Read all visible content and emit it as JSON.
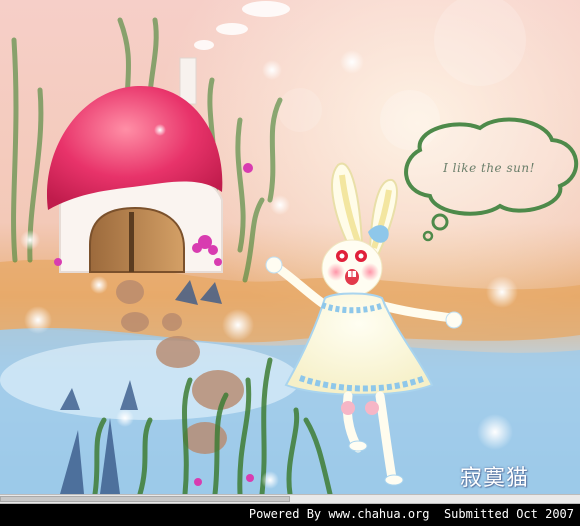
{
  "artwork": {
    "speech_bubble_text": "I like the sun!",
    "signature": "寂寞猫"
  },
  "footer": {
    "credit": "Powered By www.chahua.org  Submitted Oct 2007"
  },
  "colors": {
    "sky_pink": "#f3c6c0",
    "mushroom_red": "#e0345e",
    "water_blue": "#a8d0ea",
    "grass_green": "#4d8a3c",
    "footer_black": "#000000"
  }
}
